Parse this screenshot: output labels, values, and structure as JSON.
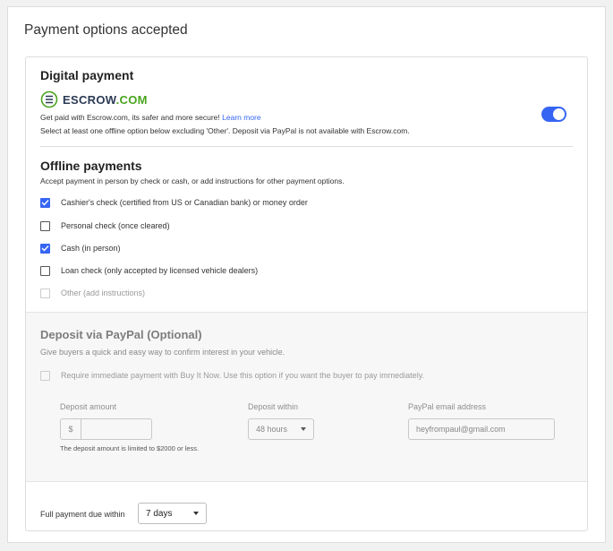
{
  "page": {
    "title": "Payment options accepted"
  },
  "digital": {
    "title": "Digital payment",
    "logo": {
      "icon": "escrow-shield-icon",
      "brand": "ESCROW",
      "suffix": ".COM"
    },
    "desc_prefix": "Get paid with Escrow.com, its safer and more secure! ",
    "learn_more": "Learn more",
    "note": "Select at least one offline option below excluding 'Other'. Deposit via PayPal is not available with Escrow.com.",
    "toggle_on": true
  },
  "offline": {
    "title": "Offline payments",
    "desc": "Accept payment in person by check or cash, or add instructions for other payment options.",
    "options": [
      {
        "label": "Cashier's check (certified from US or Canadian bank) or money order",
        "checked": true,
        "disabled": false
      },
      {
        "label": "Personal check (once cleared)",
        "checked": false,
        "disabled": false
      },
      {
        "label": "Cash (in person)",
        "checked": true,
        "disabled": false
      },
      {
        "label": "Loan check (only accepted by licensed vehicle dealers)",
        "checked": false,
        "disabled": false
      },
      {
        "label": "Other (add instructions)",
        "checked": false,
        "disabled": true
      }
    ]
  },
  "paypal": {
    "title": "Deposit via PayPal (Optional)",
    "desc": "Give buyers a quick and easy way to confirm interest in your vehicle.",
    "require_label": "Require immediate payment with Buy It Now. Use this option if you want the buyer to pay immediately.",
    "deposit_amount_label": "Deposit amount",
    "currency_symbol": "$",
    "deposit_amount_value": "",
    "deposit_note": "The deposit amount is limited to $2000 or less.",
    "deposit_within_label": "Deposit within",
    "deposit_within_value": "48 hours",
    "email_label": "PayPal email address",
    "email_value": "heyfrompaul@gmail.com"
  },
  "full_payment": {
    "label": "Full payment due within",
    "value": "7 days"
  },
  "colors": {
    "accent": "#3665f3",
    "brand_green": "#4aa51f",
    "brand_navy": "#2b3a55"
  }
}
